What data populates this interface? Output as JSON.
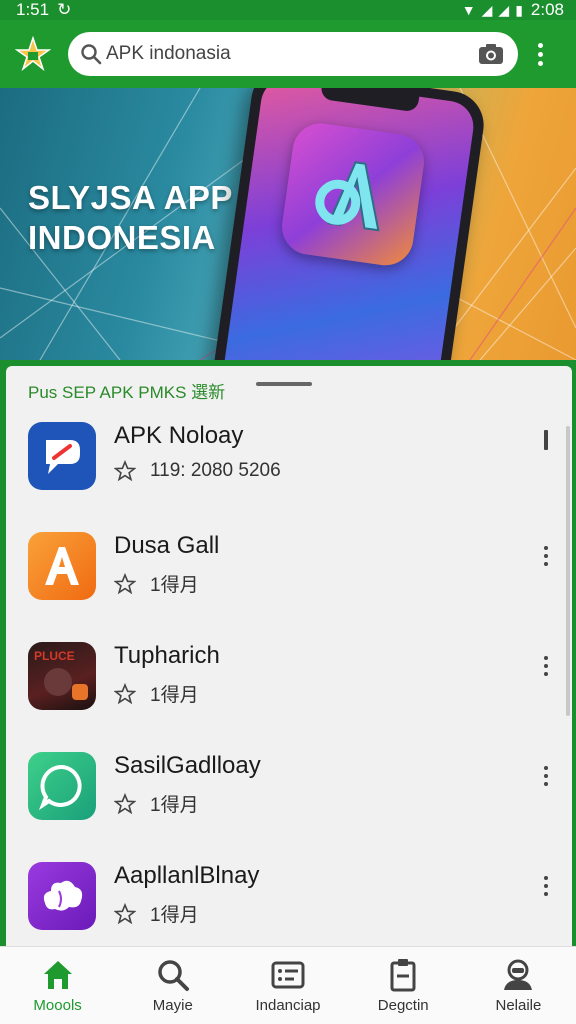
{
  "status_bar": {
    "time_left": "1:51",
    "time_right": "2:08"
  },
  "search": {
    "text": "APK indonasia"
  },
  "banner": {
    "title": "SLYJSA APP\nINDONESIA"
  },
  "section": {
    "title": "Pus SEP APK PMKS 選新"
  },
  "apps": [
    {
      "name": "APK Noloay",
      "meta": "119: 2080 5206",
      "icon": "apk-icon",
      "color": "#1f55b8"
    },
    {
      "name": "Dusa Gall",
      "meta": "1得月",
      "icon": "letter-a-icon",
      "color": "#f07a1a"
    },
    {
      "name": "Tupharich",
      "meta": "1得月",
      "icon": "game-art-icon",
      "color": "#3a1818"
    },
    {
      "name": "SasilGadlloay",
      "meta": "1得月",
      "icon": "chat-bubble-icon",
      "color": "#26b06a"
    },
    {
      "name": "AapllanlBlnay",
      "meta": "1得月",
      "icon": "cloud-blob-icon",
      "color": "#7a2bc8"
    }
  ],
  "bottom_nav": [
    {
      "label": "Moools",
      "icon": "home-icon",
      "active": true
    },
    {
      "label": "Mayie",
      "icon": "search-icon"
    },
    {
      "label": "Indanciap",
      "icon": "list-card-icon"
    },
    {
      "label": "Degctin",
      "icon": "clipboard-icon"
    },
    {
      "label": "Nelaile",
      "icon": "profile-icon"
    }
  ],
  "colors": {
    "primary": "#1f9a2f",
    "accent_text": "#2a8a2a"
  }
}
